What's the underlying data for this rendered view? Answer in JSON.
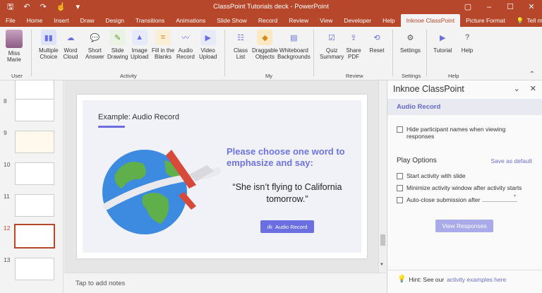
{
  "titlebar": {
    "title": "ClassPoint Tutorials deck  -  PowerPoint",
    "qat": [
      "save-icon",
      "undo-icon",
      "redo-icon",
      "touch-icon",
      "more-icon"
    ]
  },
  "tabs": [
    "File",
    "Home",
    "Insert",
    "Draw",
    "Design",
    "Transitions",
    "Animations",
    "Slide Show",
    "Record",
    "Review",
    "View",
    "Developer",
    "Help",
    "Inknoe ClassPoint",
    "Picture Format"
  ],
  "tellme": "Tell me",
  "ribbon": {
    "user": "Miss\nMarie",
    "activity": [
      "Multiple\nChoice",
      "Word\nCloud",
      "Short\nAnswer",
      "Slide\nDrawing",
      "Image\nUpload",
      "Fill in the\nBlanks",
      "Audio\nRecord",
      "Video\nUpload"
    ],
    "my": [
      "Class\nList",
      "Draggable\nObjects",
      "Whiteboard\nBackgrounds"
    ],
    "review": [
      "Quiz\nSummary",
      "Share\nPDF",
      "Reset"
    ],
    "settings": "Settings",
    "help": [
      "Tutorial",
      "Help"
    ],
    "groups": {
      "user": "User",
      "activity": "Activity",
      "my": "My",
      "review": "Review",
      "settings": "Settings",
      "help": "Help"
    }
  },
  "thumbs": [
    "8",
    "9",
    "10",
    "11",
    "12",
    "13"
  ],
  "slide": {
    "title": "Example: Audio Record",
    "heading": "Please choose one word to emphasize and say:",
    "quote": "“She isn’t flying to California tomorrow.”",
    "button": "Audio Record"
  },
  "notes": "Tap to add notes",
  "panel": {
    "title": "Inknoe ClassPoint",
    "section": "Audio Record",
    "hide_names": "Hide participant names when viewing responses",
    "play_options": "Play Options",
    "save_default": "Save as default",
    "start_activity": "Start activity with slide",
    "minimize": "Minimize activity window after activity starts",
    "autoclose": "Auto-close submission after",
    "view_responses": "View Responses",
    "hint_prefix": "Hint: See our",
    "hint_link": "activity examples here"
  },
  "colors": {
    "brand": "#b7472a",
    "accent": "#6b6ee0"
  }
}
